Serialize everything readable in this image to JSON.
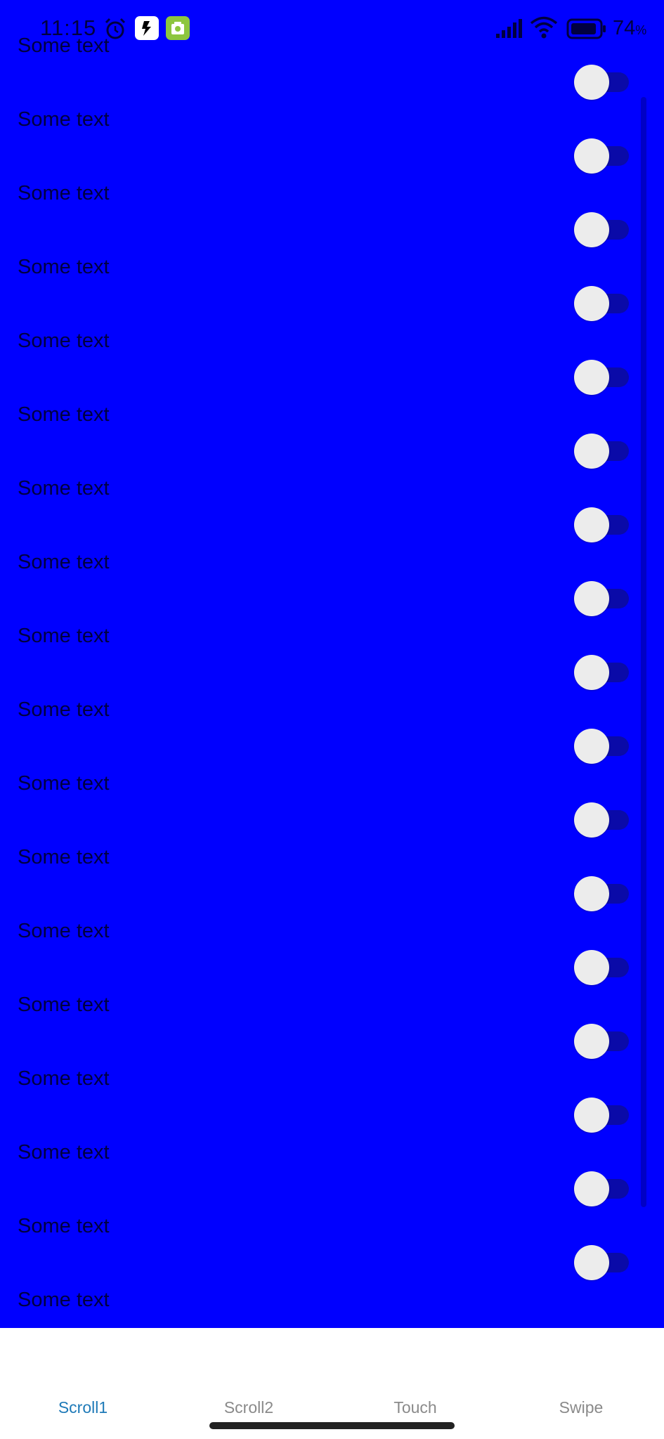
{
  "status_bar": {
    "time": "11:15",
    "battery_level": "74",
    "battery_unit": "%",
    "icons": [
      "alarm-icon",
      "app-icon-1",
      "app-icon-2",
      "signal-icon",
      "wifi-icon",
      "battery-icon"
    ]
  },
  "list": {
    "rows": [
      {
        "label": "Some text",
        "switch_on": false
      },
      {
        "label": "Some text",
        "switch_on": false
      },
      {
        "label": "Some text",
        "switch_on": false
      },
      {
        "label": "Some text",
        "switch_on": false
      },
      {
        "label": "Some text",
        "switch_on": false
      },
      {
        "label": "Some text",
        "switch_on": false
      },
      {
        "label": "Some text",
        "switch_on": false
      },
      {
        "label": "Some text",
        "switch_on": false
      },
      {
        "label": "Some text",
        "switch_on": false
      },
      {
        "label": "Some text",
        "switch_on": false
      },
      {
        "label": "Some text",
        "switch_on": false
      },
      {
        "label": "Some text",
        "switch_on": false
      },
      {
        "label": "Some text",
        "switch_on": false
      },
      {
        "label": "Some text",
        "switch_on": false
      },
      {
        "label": "Some text",
        "switch_on": false
      },
      {
        "label": "Some text",
        "switch_on": false
      },
      {
        "label": "Some text",
        "switch_on": false
      },
      {
        "label": "Some text",
        "switch_on": false
      }
    ]
  },
  "bottom_nav": {
    "tabs": [
      {
        "label": "Scroll1",
        "active": true
      },
      {
        "label": "Scroll2",
        "active": false
      },
      {
        "label": "Touch",
        "active": false
      },
      {
        "label": "Swipe",
        "active": false
      }
    ]
  },
  "colors": {
    "background": "#0000ff",
    "text": "#000040",
    "switch_thumb": "#ececec",
    "switch_track": "#0a0aa8",
    "nav_active": "#1e7ab8",
    "nav_inactive": "#8a8a8a"
  }
}
